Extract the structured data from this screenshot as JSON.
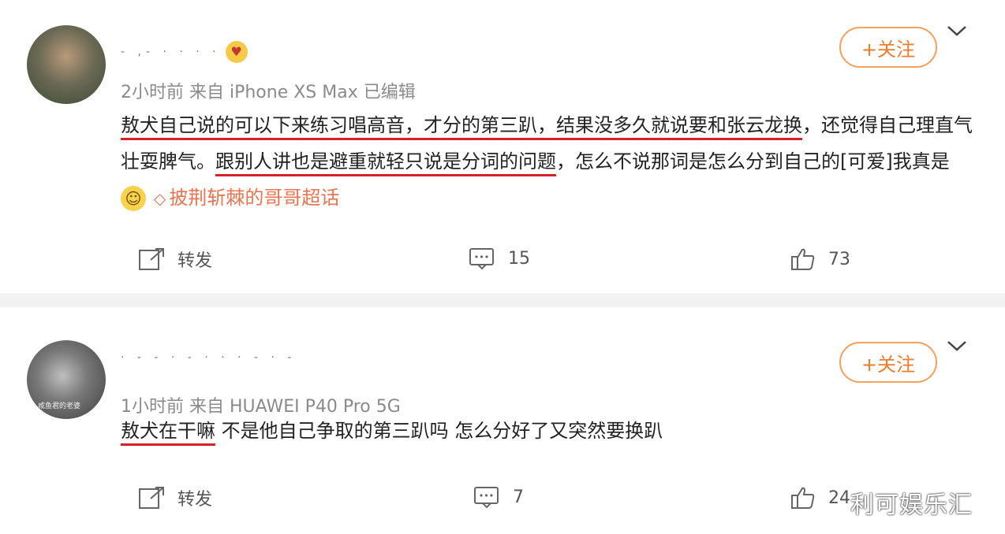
{
  "posts": [
    {
      "username": "- ,- · · · ·",
      "meta": "2小时前  来自 iPhone XS Max 已编辑",
      "follow_label": "+关注",
      "text": {
        "seg1_ul": "敖犬自己说的可以下来练习唱高音，才分的第三趴，结果没多久就说要和张云龙换",
        "seg2": "，还觉得自己理直气壮耍脾气。",
        "seg3_ul": "跟别人讲也是避重就轻只说是分词的问题",
        "seg4": "，怎么不说那词是怎么分到自己的[可爱]我真是",
        "topic": "披荆斩棘的哥哥超话"
      },
      "actions": {
        "repost": "转发",
        "comments": "15",
        "likes": "73"
      }
    },
    {
      "username": "· - - · - · · · - · -",
      "meta": "1小时前  来自 HUAWEI P40 Pro 5G",
      "avatar_caption": "咸鱼君的老婆",
      "follow_label": "+关注",
      "text": {
        "seg1_ul": "敖犬在干嘛",
        "seg2": " 不是他自己争取的第三趴吗 怎么分好了又突然要换趴"
      },
      "actions": {
        "repost": "转发",
        "comments": "7",
        "likes": "24"
      }
    }
  ],
  "watermark": "利可娱乐汇",
  "colors": {
    "accent": "#f07b28",
    "underline": "#d8202a",
    "topic": "#eb7350"
  }
}
